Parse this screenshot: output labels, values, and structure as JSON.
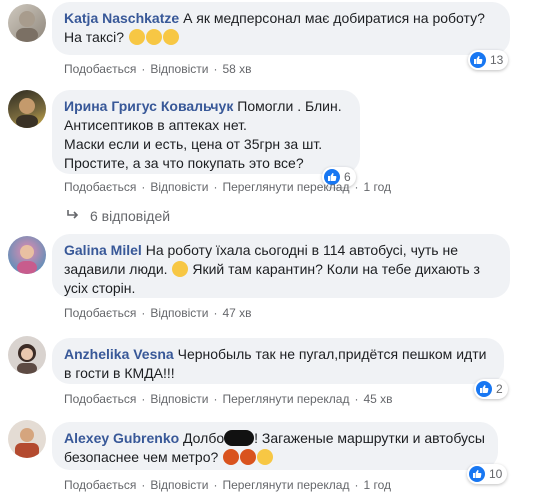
{
  "comments": [
    {
      "author": "Katja Naschkatze",
      "text_lines": [
        "А як медперсонал має добиратися на роботу?",
        "На таксі?"
      ],
      "emojis": [
        "thinking-face-icon",
        "thinking-face-icon",
        "thinking-face-icon"
      ],
      "reaction_count": "13",
      "actions": {
        "like": "Подобається",
        "reply": "Відповісти",
        "time": "58 хв"
      }
    },
    {
      "author": "Ирина Григус Ковальчук",
      "first_line_text": "Помогли . Блин.",
      "text_lines": [
        "Антисептиков в аптеках нет.",
        "Маски если и есть, цена от 35грн за шт.",
        "Простите, а за что покупать это все?"
      ],
      "reaction_count": "6",
      "actions": {
        "like": "Подобається",
        "reply": "Відповісти",
        "translate": "Переглянути переклад",
        "time": "1 год"
      },
      "replies_label": "6 відповідей"
    },
    {
      "author": "Galina Milel",
      "first_line_text": "На роботу їхала сьогодні в 114 автобусі, чуть не",
      "text_lines": [
        "задавили люди.",
        "Який там карантин? Коли на тебе дихають з",
        "усіх сторін."
      ],
      "actions": {
        "like": "Подобається",
        "reply": "Відповісти",
        "time": "47 хв"
      }
    },
    {
      "author": "Anzhelika Vesna",
      "first_line_text": "Чернобыль так не пугал,придётся пешком идти",
      "text_lines": [
        "в гости в КМДА!!!"
      ],
      "reaction_count": "2",
      "actions": {
        "like": "Подобається",
        "reply": "Відповісти",
        "translate": "Переглянути переклад",
        "time": "45 хв"
      }
    },
    {
      "author": "Alexey Gubrenko",
      "first_line_pre": "Долбо",
      "first_line_post": "! Загаженые маршрутки и автобусы",
      "text_lines": [
        "безопаснее чем метро?"
      ],
      "reaction_count": "10",
      "actions": {
        "like": "Подобається",
        "reply": "Відповісти",
        "translate": "Переглянути переклад",
        "time": "1 год"
      }
    }
  ],
  "colors": {
    "name": "#385898",
    "bubble": "#f0f2f5",
    "like": "#1877f2",
    "meta": "#65676b"
  }
}
